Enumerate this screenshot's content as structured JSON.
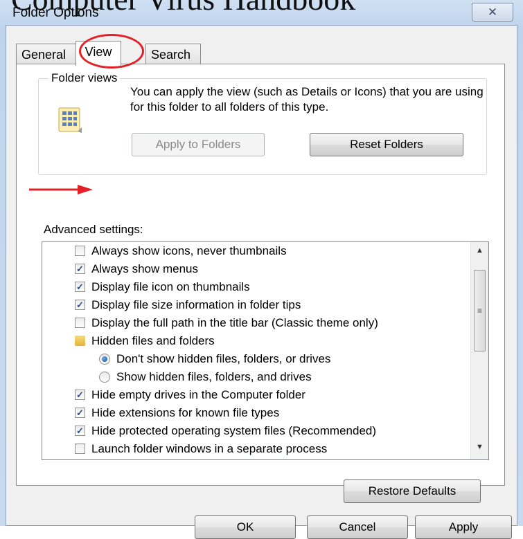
{
  "overlay": {
    "title": "Computer Virus Handbook"
  },
  "window": {
    "title": "Folder Options",
    "close_glyph": "✕"
  },
  "tabs": [
    {
      "label": "General",
      "active": false
    },
    {
      "label": "View",
      "active": true
    },
    {
      "label": "Search",
      "active": false
    }
  ],
  "folder_views": {
    "legend": "Folder views",
    "description": "You can apply the view (such as Details or Icons) that you are using for this folder to all folders of this type.",
    "apply_label": "Apply to Folders",
    "reset_label": "Reset Folders",
    "icon": "folder-views-icon"
  },
  "advanced": {
    "label": "Advanced settings:",
    "items": [
      {
        "type": "checkbox",
        "checked": false,
        "label": "Always show icons, never thumbnails"
      },
      {
        "type": "checkbox",
        "checked": true,
        "label": "Always show menus"
      },
      {
        "type": "checkbox",
        "checked": true,
        "label": "Display file icon on thumbnails"
      },
      {
        "type": "checkbox",
        "checked": true,
        "label": "Display file size information in folder tips"
      },
      {
        "type": "checkbox",
        "checked": false,
        "label": "Display the full path in the title bar (Classic theme only)"
      },
      {
        "type": "folder",
        "label": "Hidden files and folders"
      },
      {
        "type": "radio",
        "checked": true,
        "label": "Don't show hidden files, folders, or drives"
      },
      {
        "type": "radio",
        "checked": false,
        "label": "Show hidden files, folders, and drives"
      },
      {
        "type": "checkbox",
        "checked": true,
        "label": "Hide empty drives in the Computer folder"
      },
      {
        "type": "checkbox",
        "checked": true,
        "label": "Hide extensions for known file types"
      },
      {
        "type": "checkbox",
        "checked": true,
        "label": "Hide protected operating system files (Recommended)"
      },
      {
        "type": "checkbox",
        "checked": false,
        "label": "Launch folder windows in a separate process"
      }
    ],
    "restore_label": "Restore Defaults",
    "scroll_up": "▲",
    "scroll_down": "▼",
    "scroll_grip": "≡"
  },
  "buttons": {
    "ok": "OK",
    "cancel": "Cancel",
    "apply": "Apply"
  },
  "colors": {
    "annotation_red": "#e22025",
    "title_bar": "#c7d9ee"
  }
}
